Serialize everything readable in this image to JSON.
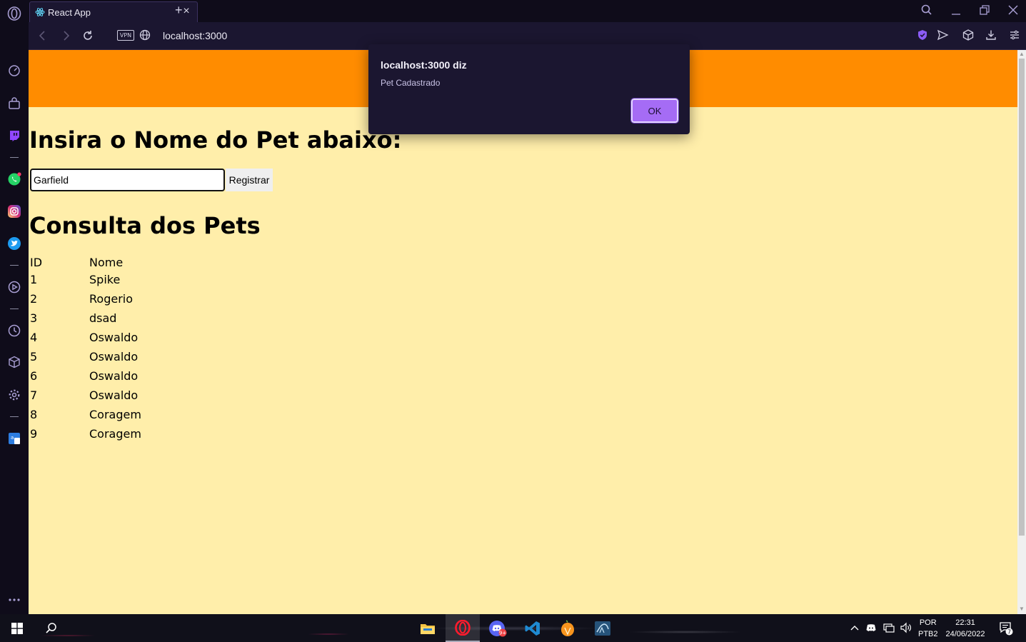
{
  "browser": {
    "tab_title": "React App",
    "url": "localhost:3000",
    "vpn_label": "VPN",
    "accent": "#8b5cf6"
  },
  "sidebar": {
    "icons": [
      "opera-logo-icon",
      "speed-dial-icon",
      "shopping-icon",
      "twitch-icon",
      "whatsapp-icon",
      "instagram-icon",
      "twitter-icon",
      "player-icon",
      "history-icon",
      "extensions-icon",
      "settings-icon",
      "translate-icon",
      "more-icon"
    ]
  },
  "page": {
    "header_color": "#ff8c00",
    "background_color": "#ffeeaa",
    "heading": "Insira o Nome do Pet abaixo:",
    "input_value": "Garfield",
    "register_button": "Registrar",
    "consulta_heading": "Consulta dos Pets",
    "table": {
      "headers": [
        "ID",
        "Nome"
      ],
      "rows": [
        [
          "1",
          "Spike"
        ],
        [
          "2",
          "Rogerio"
        ],
        [
          "3",
          "dsad"
        ],
        [
          "4",
          "Oswaldo"
        ],
        [
          "5",
          "Oswaldo"
        ],
        [
          "6",
          "Oswaldo"
        ],
        [
          "7",
          "Oswaldo"
        ],
        [
          "8",
          "Coragem"
        ],
        [
          "9",
          "Coragem"
        ]
      ]
    }
  },
  "alert": {
    "title": "localhost:3000 diz",
    "message": "Pet Cadastrado",
    "ok_label": "OK"
  },
  "taskbar": {
    "apps": [
      "windows-start-icon",
      "search-icon",
      "file-explorer-icon",
      "opera-icon",
      "discord-icon",
      "vscode-icon",
      "fl-studio-icon",
      "mysql-workbench-icon"
    ],
    "discord_badge": "9+",
    "lang_top": "POR",
    "lang_bottom": "PTB2",
    "time": "22:31",
    "date": "24/06/2022",
    "notification_count": "7"
  }
}
